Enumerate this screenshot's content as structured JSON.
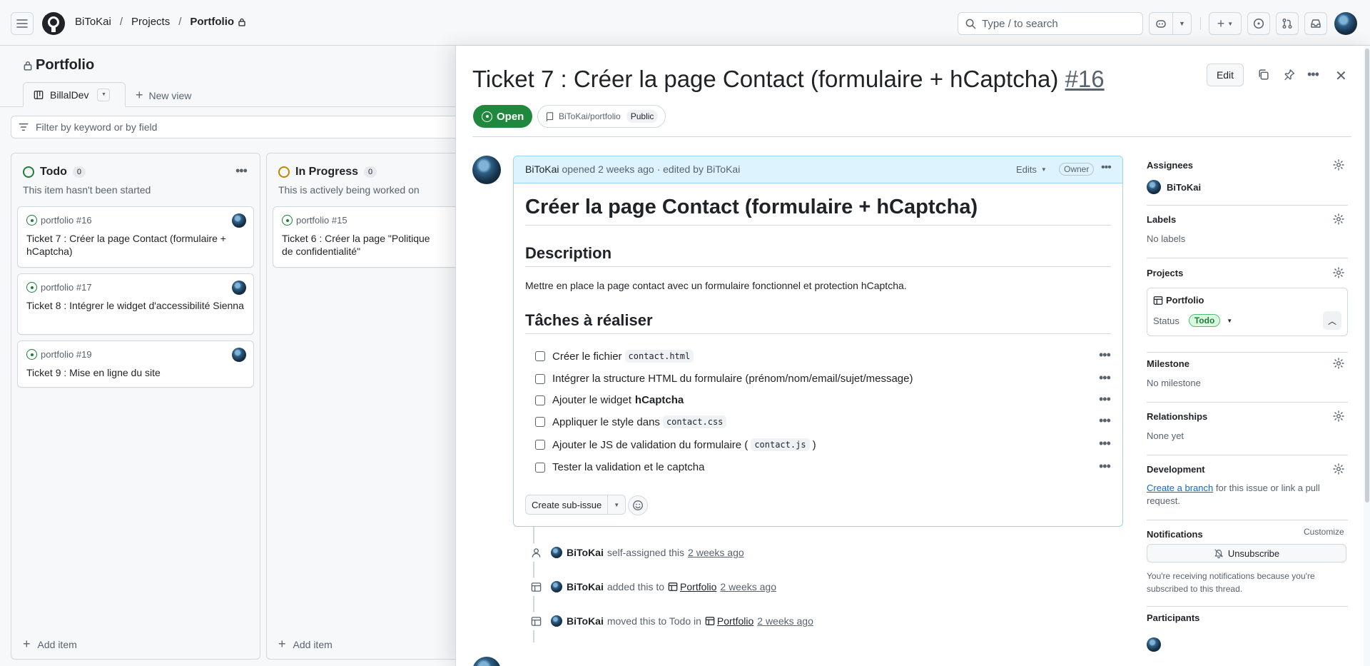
{
  "header": {
    "owner": "BiToKai",
    "projects": "Projects",
    "project": "Portfolio",
    "search_placeholder": "Type / to search"
  },
  "board": {
    "title": "Portfolio",
    "view_tab": "BillalDev",
    "new_view": "New view",
    "filter_placeholder": "Filter by keyword or by field",
    "columns": [
      {
        "name": "Todo",
        "count": "0",
        "description": "This item hasn't been started",
        "add_item": "Add item",
        "cards": [
          {
            "ref": "portfolio #16",
            "title": "Ticket 7 : Créer la page Contact (formulaire + hCaptcha)"
          },
          {
            "ref": "portfolio #17",
            "title": "Ticket 8 : Intégrer le widget d'accessibilité Sienna"
          },
          {
            "ref": "portfolio #19",
            "title": "Ticket 9 : Mise en ligne du site"
          }
        ]
      },
      {
        "name": "In Progress",
        "count": "0",
        "description": "This is actively being worked on",
        "add_item": "Add item",
        "cards": [
          {
            "ref": "portfolio #15",
            "title": "Ticket 6 : Créer la page \"Politique de confidentialité\""
          }
        ]
      }
    ]
  },
  "issue": {
    "title": "Ticket 7 : Créer la page Contact (formulaire + hCaptcha)",
    "number": "#16",
    "edit_label": "Edit",
    "state": "Open",
    "repo": "BiToKai/portfolio",
    "visibility": "Public",
    "comment": {
      "author": "BiToKai",
      "meta": "opened 2 weeks ago · edited by BiToKai",
      "edits": "Edits",
      "role": "Owner",
      "h1": "Créer la page Contact (formulaire + hCaptcha)",
      "h2_description": "Description",
      "description": "Mettre en place la page contact avec un formulaire fonctionnel et protection hCaptcha.",
      "h2_tasks": "Tâches à réaliser",
      "tasks": [
        {
          "before": "Créer le fichier",
          "code": "contact.html",
          "after": ""
        },
        {
          "before": "Intégrer la structure HTML du formulaire (prénom/nom/email/sujet/message)",
          "code": "",
          "after": ""
        },
        {
          "before": "Ajouter le widget",
          "bold": "hCaptcha"
        },
        {
          "before": "Appliquer le style dans",
          "code": "contact.css",
          "after": ""
        },
        {
          "before": "Ajouter le JS de validation du formulaire (",
          "code": "contact.js",
          "after": ")"
        },
        {
          "before": "Tester la validation et le captcha",
          "code": "",
          "after": ""
        }
      ],
      "create_sub_issue": "Create sub-issue"
    },
    "timeline": [
      {
        "actor": "BiToKai",
        "text": "self-assigned this",
        "project": "",
        "time": "2 weeks ago"
      },
      {
        "actor": "BiToKai",
        "text": "added this to",
        "project": "Portfolio",
        "time": "2 weeks ago"
      },
      {
        "actor": "BiToKai",
        "text": "moved this to Todo in",
        "project": "Portfolio",
        "time": "2 weeks ago"
      }
    ]
  },
  "sidebar": {
    "assignees_label": "Assignees",
    "assignee": "BiToKai",
    "labels_label": "Labels",
    "labels_value": "No labels",
    "projects_label": "Projects",
    "project_name": "Portfolio",
    "status_label": "Status",
    "status_value": "Todo",
    "milestone_label": "Milestone",
    "milestone_value": "No milestone",
    "relationships_label": "Relationships",
    "relationships_value": "None yet",
    "development_label": "Development",
    "create_branch": "Create a branch",
    "development_text": "for this issue or link a pull request.",
    "notifications_label": "Notifications",
    "customize": "Customize",
    "unsubscribe": "Unsubscribe",
    "notification_reason": "You're receiving notifications because you're subscribed to this thread.",
    "participants_label": "Participants"
  },
  "colors": {
    "accent": "#0969da",
    "open": "#1f883d",
    "todo": "#1a7f37",
    "in_progress": "#bf8700"
  }
}
